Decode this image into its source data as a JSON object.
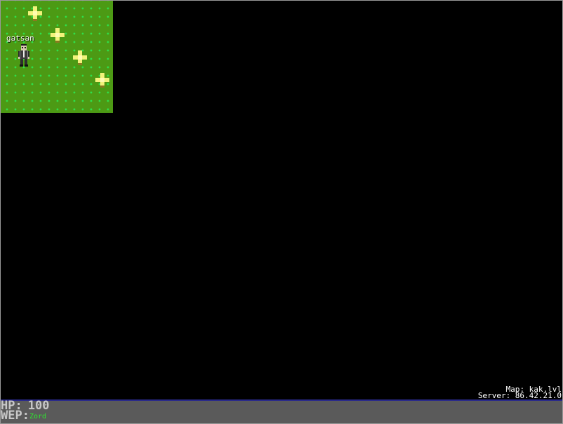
{
  "player": {
    "name": "gatsan"
  },
  "hud": {
    "hp_label": "HP:",
    "hp_value": "100",
    "wep_label": "WEP:",
    "wep_value": "Zord"
  },
  "status": {
    "map": "Map: kak.lvl",
    "server": "Server: 86.42.21.0"
  },
  "colors": {
    "grass": "#4c9a14",
    "grass_dots": "#2fe04a",
    "flower": "#f2f27a",
    "hud_bg": "#5a5a5a",
    "weapon_text": "#2ee82e"
  },
  "icons": {
    "flower": "flower-cross-icon",
    "player": "player-sprite"
  }
}
